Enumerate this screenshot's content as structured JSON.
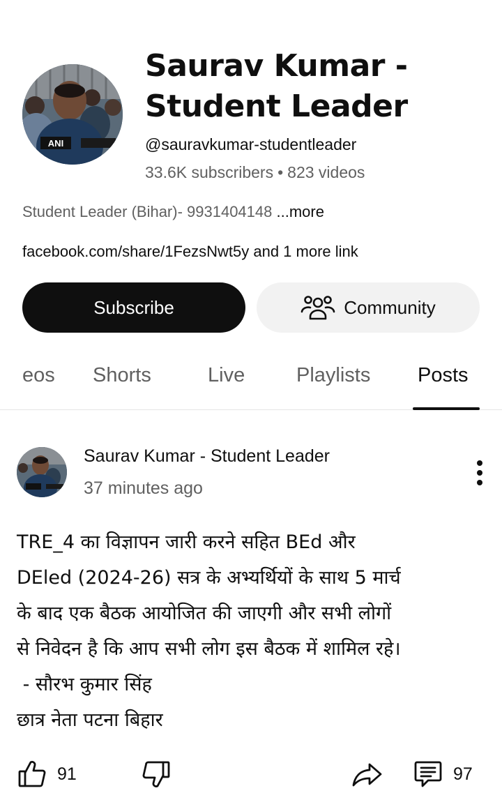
{
  "channel": {
    "title_line1": "Saurav Kumar -",
    "title_line2": "Student Leader",
    "handle": "@sauravkumar-studentleader",
    "subscribers": "33.6K subscribers",
    "separator": "•",
    "videos": "823 videos",
    "description": "Student Leader (Bihar)- 9931404148 ",
    "more_label": "...more",
    "link_text": "facebook.com/share/1FezsNwt5y and 1 more link",
    "subscribe_label": "Subscribe",
    "community_label": "Community",
    "avatar_watermark": "ANI"
  },
  "tabs": [
    {
      "label": "eos"
    },
    {
      "label": "Shorts"
    },
    {
      "label": "Live"
    },
    {
      "label": "Playlists"
    },
    {
      "label": "Posts",
      "active": true
    }
  ],
  "post": {
    "author": "Saurav Kumar - Student Leader",
    "time": "37 minutes ago",
    "body": "TRE_4 का विज्ञापन जारी करने सहित BEd और\nDEled (2024-26) सत्र के अभ्यर्थियों के साथ 5 मार्च\nके बाद एक बैठक आयोजित की जाएगी और सभी लोगों\nसे निवेदन है कि आप सभी लोग इस बैठक में शामिल रहे।\n - सौरभ कुमार सिंह\nछात्र नेता पटना बिहार",
    "likes": "91",
    "comments": "97"
  },
  "icons": {
    "community": "community-icon",
    "like": "thumbs-up-icon",
    "dislike": "thumbs-down-icon",
    "share": "share-icon",
    "comment": "comment-icon",
    "menu": "more-vertical-icon"
  }
}
